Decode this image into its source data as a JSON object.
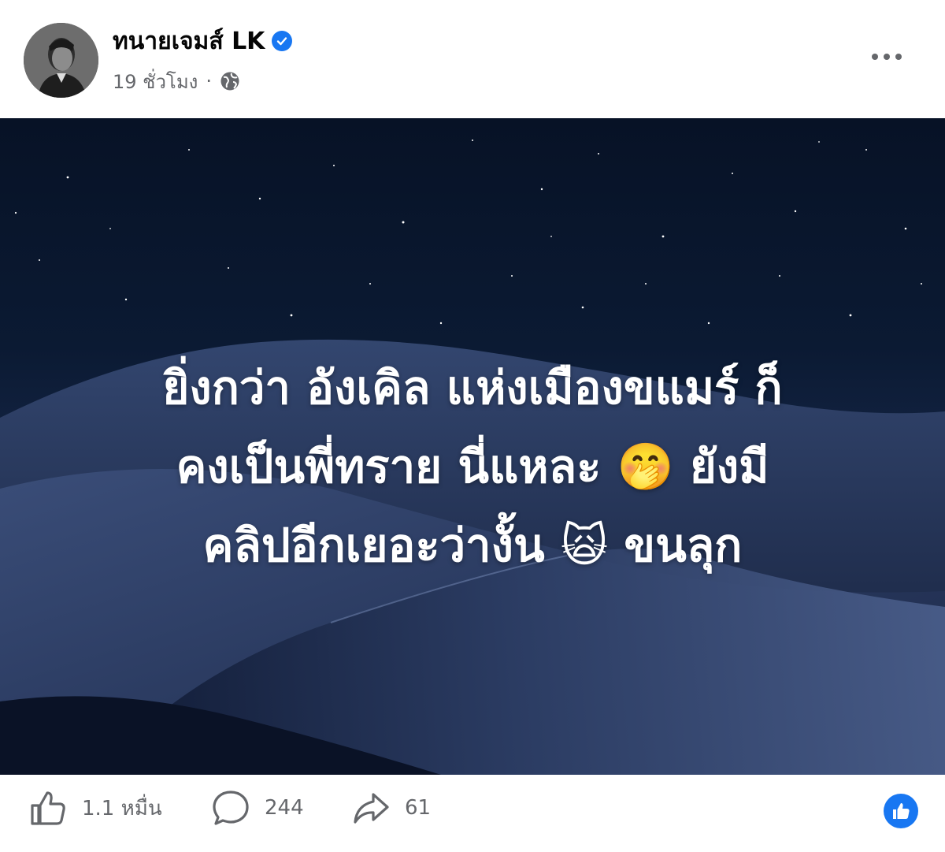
{
  "header": {
    "author_name": "ทนายเจมส์ LK",
    "time": "19 ชั่วโมง",
    "separator": "·",
    "audience_icon": "globe-icon",
    "verified_icon": "verified-badge-icon",
    "more_icon": "more-options-icon"
  },
  "media": {
    "lines": [
      "ยิ่งกว่า อังเคิล แห่งเมืองขแมร์ ก็",
      "คงเป็นพี่ทราย นี่แหละ 🤭 ยังมี",
      "คลิปอีกเยอะว่างั้น 🙀 ขนลุก"
    ]
  },
  "footer": {
    "likes": "1.1 หมื่น",
    "comments": "244",
    "shares": "61",
    "like_icon": "thumbs-up-icon",
    "comment_icon": "comment-bubble-icon",
    "share_icon": "share-arrow-icon",
    "reaction_icon": "like-reaction-icon"
  },
  "colors": {
    "accent": "#1877f2",
    "secondary_text": "#65676b",
    "primary_text": "#050505",
    "sky": "#071226"
  }
}
